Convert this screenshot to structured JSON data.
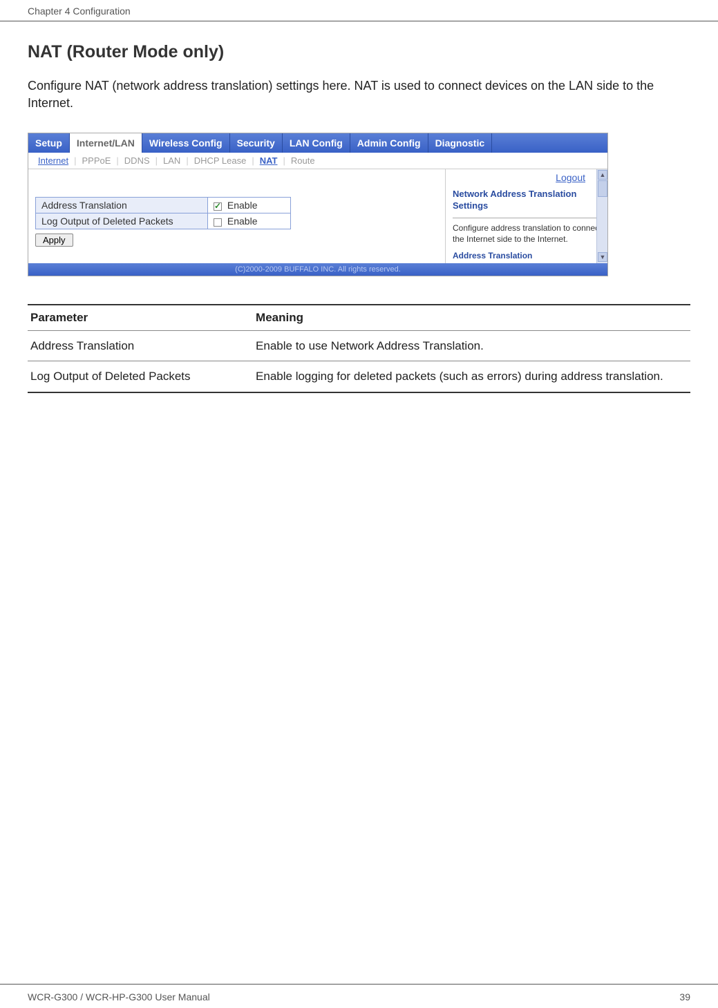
{
  "header": {
    "chapter": "Chapter 4  Configuration"
  },
  "section": {
    "title": "NAT (Router Mode only)",
    "description": "Configure NAT (network address translation) settings here.  NAT is used to connect devices on the LAN side to the Internet."
  },
  "ui": {
    "main_tabs": [
      {
        "label": "Setup",
        "active": false
      },
      {
        "label": "Internet/LAN",
        "active": true
      },
      {
        "label": "Wireless Config",
        "active": false
      },
      {
        "label": "Security",
        "active": false
      },
      {
        "label": "LAN Config",
        "active": false
      },
      {
        "label": "Admin Config",
        "active": false
      },
      {
        "label": "Diagnostic",
        "active": false
      }
    ],
    "sub_tabs": [
      {
        "label": "Internet",
        "state": "link"
      },
      {
        "label": "PPPoE",
        "state": "inactive"
      },
      {
        "label": "DDNS",
        "state": "inactive"
      },
      {
        "label": "LAN",
        "state": "inactive"
      },
      {
        "label": "DHCP Lease",
        "state": "inactive"
      },
      {
        "label": "NAT",
        "state": "active"
      },
      {
        "label": "Route",
        "state": "inactive"
      }
    ],
    "logout": "Logout",
    "settings": {
      "rows": [
        {
          "label": "Address Translation",
          "checked": true,
          "option": "Enable"
        },
        {
          "label": "Log Output of Deleted Packets",
          "checked": false,
          "option": "Enable"
        }
      ],
      "apply": "Apply"
    },
    "help": {
      "title": "Network Address Translation Settings",
      "text": "Configure address translation to connect the Internet side to the Internet.",
      "subheading": "Address Translation"
    },
    "copyright": "(C)2000-2009 BUFFALO INC. All rights reserved."
  },
  "params": {
    "header_param": "Parameter",
    "header_meaning": "Meaning",
    "rows": [
      {
        "param": "Address Translation",
        "meaning": "Enable to use Network Address Translation."
      },
      {
        "param": "Log Output of Deleted Packets",
        "meaning": "Enable logging for deleted packets (such as errors) during address translation."
      }
    ]
  },
  "footer": {
    "manual": "WCR-G300 / WCR-HP-G300 User Manual",
    "page": "39"
  }
}
